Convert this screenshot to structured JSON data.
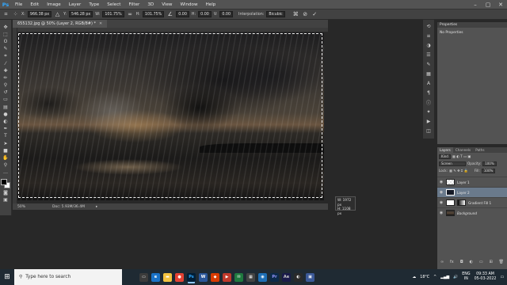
{
  "app": {
    "logo": "Ps"
  },
  "menu": [
    "File",
    "Edit",
    "Image",
    "Layer",
    "Type",
    "Select",
    "Filter",
    "3D",
    "View",
    "Window",
    "Help"
  ],
  "options": {
    "x_label": "X:",
    "x_value": "966.38 px",
    "y_label": "Y:",
    "y_value": "546.28 px",
    "w_label": "W:",
    "w_value": "101.75%",
    "h_label": "H:",
    "h_value": "101.75%",
    "angle_value": "0.00",
    "h_skew_label": "H:",
    "h_skew_value": "0.00",
    "v_skew_label": "V:",
    "v_skew_value": "0.00",
    "interpolation_label": "Interpolation:",
    "interpolation_value": "Bicubic"
  },
  "document": {
    "tab_title": "655132.jpg @ 50% (Layer 2, RGB/8#) *",
    "size_tip_w": "W: 1972 px",
    "size_tip_h": "H: 1108 px",
    "zoom": "50%",
    "doc_size": "Doc: 5.93M/36.4M"
  },
  "properties": {
    "title": "Properties",
    "body": "No Properties"
  },
  "layers_panel": {
    "tabs": [
      "Layers",
      "Channels",
      "Paths"
    ],
    "kind_label": "Kind",
    "blend_mode": "Screen",
    "opacity_label": "Opacity:",
    "opacity_value": "100%",
    "lock_label": "Lock:",
    "fill_label": "Fill:",
    "fill_value": "100%",
    "layers": [
      {
        "name": "Layer 1",
        "thumb": "checker",
        "selected": false
      },
      {
        "name": "Layer 2",
        "thumb": "dark",
        "selected": true
      },
      {
        "name": "Gradient Fill 1",
        "thumb": "grad",
        "selected": false
      },
      {
        "name": "Background",
        "thumb": "photo-t",
        "selected": false
      }
    ]
  },
  "taskbar": {
    "search_placeholder": "Type here to search",
    "weather": "18°C",
    "language": "ENG",
    "region": "IN",
    "time": "09:33 AM",
    "date": "05-03-2022"
  },
  "colors": {
    "accent": "#31a8ff",
    "panel": "#535353",
    "dark": "#282828",
    "taskbar": "#1f2a33"
  }
}
